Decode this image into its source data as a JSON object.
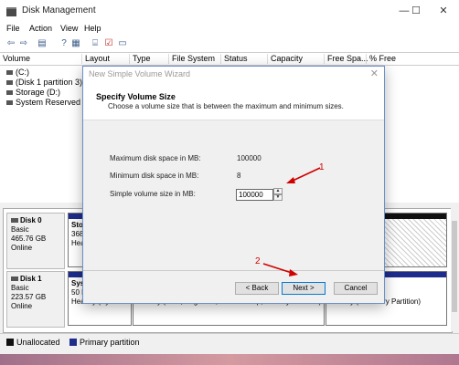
{
  "app": {
    "title": "Disk Management"
  },
  "window_controls": {
    "minimize": "—",
    "maximize": "☐",
    "close": "✕"
  },
  "menu": [
    "File",
    "Action",
    "View",
    "Help"
  ],
  "toolbar": [
    "back-icon",
    "forward-icon",
    "list-view-icon",
    "help-icon",
    "properties-icon",
    "rescan-icon",
    "refresh-icon",
    "disk-icon",
    "wizard-icon"
  ],
  "columns": [
    "Volume",
    "Layout",
    "Type",
    "File System",
    "Status",
    "Capacity",
    "Free Spa...",
    "% Free"
  ],
  "volumes": [
    "(C:)",
    "(Disk 1 partition 3)",
    "Storage (D:)",
    "System Reserved"
  ],
  "volume_pct_partial": "%",
  "disks": [
    {
      "name": "Disk 0",
      "type": "Basic",
      "size": "465.76 GB",
      "status": "Online",
      "partition": {
        "name": "Sto",
        "size": "368.",
        "health": "Heal"
      }
    },
    {
      "name": "Disk 1",
      "type": "Basic",
      "size": "223.57 GB",
      "status": "Online",
      "partitions": [
        {
          "name": "Sys",
          "size": "50 M",
          "health": "Healthy (System"
        },
        {
          "health": "Healthy (Boot, Page File, Crash Dump, Primary Partition)"
        },
        {
          "health": "Healthy (Recovery Partition)"
        }
      ]
    }
  ],
  "legend": [
    {
      "label": "Unallocated",
      "color": "#111111"
    },
    {
      "label": "Primary partition",
      "color": "#1e2d8c"
    }
  ],
  "dialog": {
    "title": "New Simple Volume Wizard",
    "heading": "Specify Volume Size",
    "subheading": "Choose a volume size that is between the maximum and minimum sizes.",
    "max_label": "Maximum disk space in MB:",
    "max_value": "100000",
    "min_label": "Minimum disk space in MB:",
    "min_value": "8",
    "size_label": "Simple volume size in MB:",
    "size_value": "100000",
    "back": "< Back",
    "next": "Next >",
    "cancel": "Cancel"
  },
  "annotations": {
    "one": "1",
    "two": "2"
  }
}
